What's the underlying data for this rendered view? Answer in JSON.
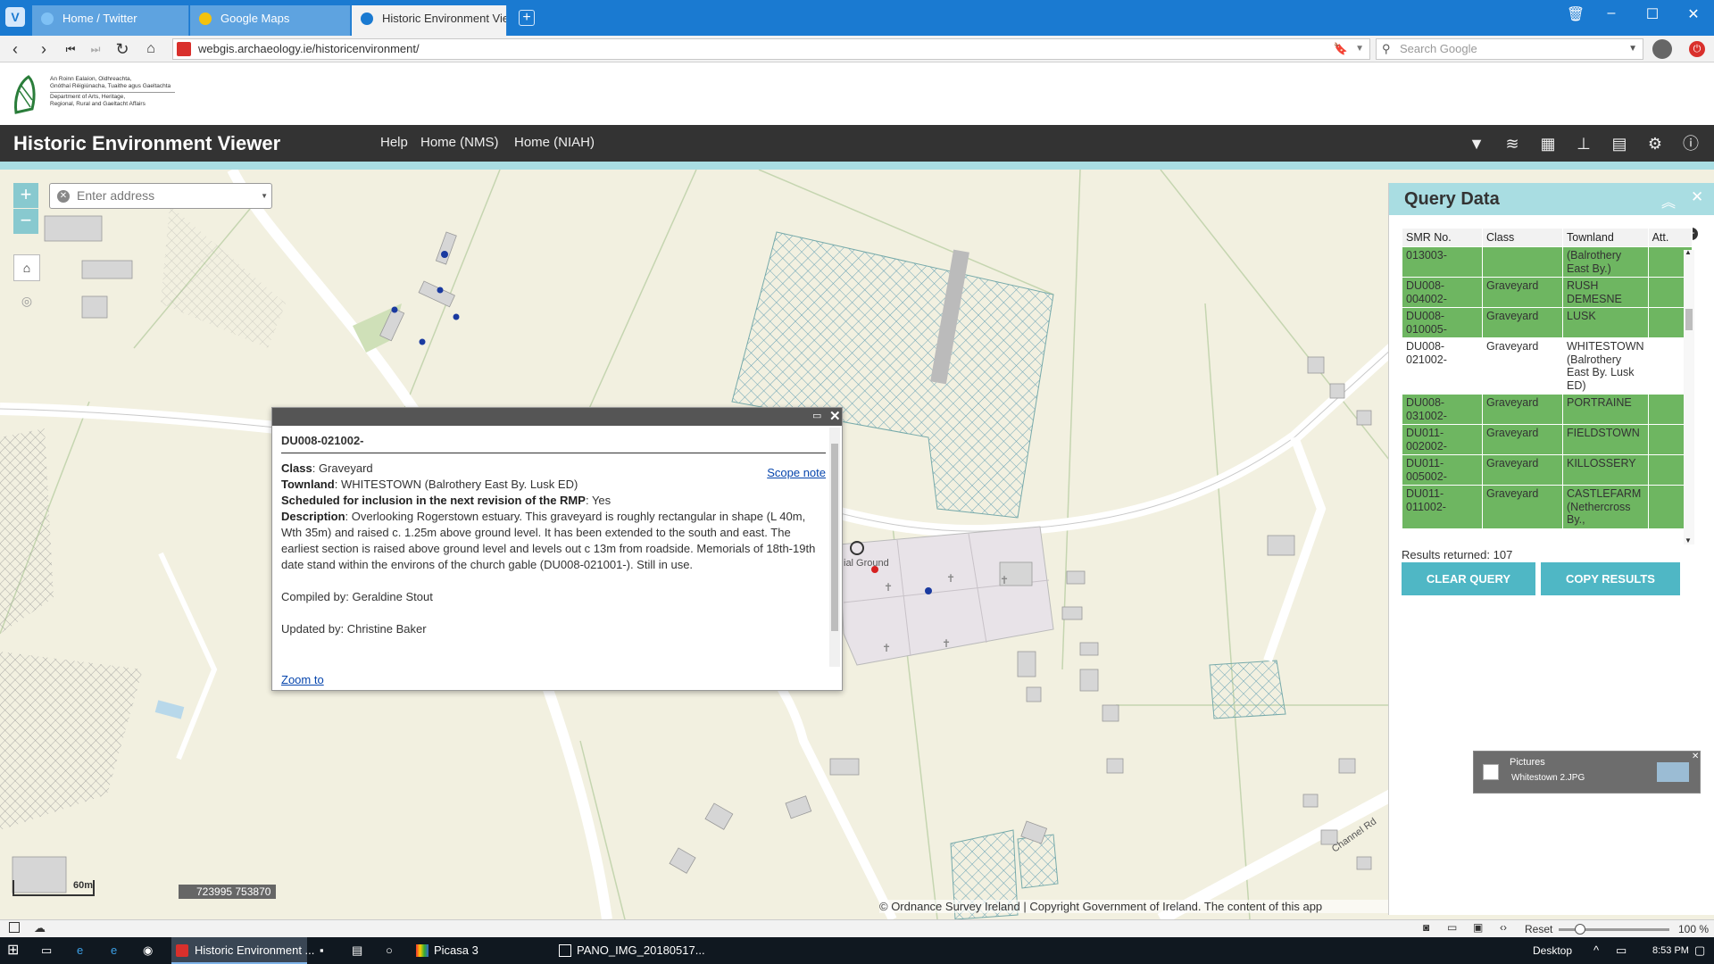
{
  "browser": {
    "tabs": [
      {
        "label": "Home / Twitter"
      },
      {
        "label": "Google Maps"
      },
      {
        "label": "Historic Environment Viewer"
      }
    ],
    "url": "webgis.archaeology.ie/historicenvironment/",
    "search_placeholder": "Search Google"
  },
  "header": {
    "logo_lines": [
      "An Roinn Ealaíon, Oidhreachta,",
      "Gnóthaí Réigiúnacha, Tuaithe agus Gaeltachta",
      "Department of Arts, Heritage,",
      "Regional, Rural and Gaeltacht Affairs"
    ],
    "app_title": "Historic Environment Viewer",
    "nav": [
      "Help",
      "Home (NMS)",
      "Home (NIAH)"
    ]
  },
  "map": {
    "address_placeholder": "Enter address",
    "scale_label": "60m",
    "coords": "723995 753870",
    "attribution": "© Ordnance Survey Ireland | Copyright Government of Ireland. The content of this app",
    "label_burial": "ial Ground",
    "label_road": "Channel Rd"
  },
  "popup": {
    "title": "DU008-021002-",
    "class_label": "Class",
    "class_value": "Graveyard",
    "scope_note": "Scope note",
    "townland_label": "Townland",
    "townland_value": "WHITESTOWN (Balrothery East By. Lusk ED)",
    "scheduled_label": "Scheduled for inclusion in the next revision of the RMP",
    "scheduled_value": "Yes",
    "desc_label": "Description",
    "desc_value": "Overlooking Rogerstown estuary. This graveyard is roughly rectangular in shape (L 40m, Wth 35m) and raised c. 1.25m above ground level. It has been extended to the south and east. The earliest section is raised above ground level and levels out c 13m from roadside. Memorials of 18th-19th date stand within the environs of the church gable (DU008-021001-). Still in use.",
    "compiled": "Compiled by: Geraldine Stout",
    "updated": "Updated by: Christine Baker",
    "zoom": "Zoom to"
  },
  "query": {
    "title": "Query Data",
    "columns": [
      "SMR No.",
      "Class",
      "Townland",
      "Att."
    ],
    "rows": [
      {
        "smr": "013003-",
        "cls": "",
        "town": "(Balrothery East By.)"
      },
      {
        "smr": "DU008-004002-",
        "cls": "Graveyard",
        "town": "RUSH DEMESNE"
      },
      {
        "smr": "DU008-010005-",
        "cls": "Graveyard",
        "town": "LUSK"
      },
      {
        "smr": "DU008-021002-",
        "cls": "Graveyard",
        "town": "WHITESTOWN (Balrothery East By. Lusk ED)"
      },
      {
        "smr": "DU008-031002-",
        "cls": "Graveyard",
        "town": "PORTRAINE"
      },
      {
        "smr": "DU011-002002-",
        "cls": "Graveyard",
        "town": "FIELDSTOWN"
      },
      {
        "smr": "DU011-005002-",
        "cls": "Graveyard",
        "town": "KILLOSSERY"
      },
      {
        "smr": "DU011-011002-",
        "cls": "Graveyard",
        "town": "CASTLEFARM (Nethercross By.,"
      }
    ],
    "results": "Results returned: 107",
    "clear": "CLEAR QUERY",
    "copy": "COPY RESULTS"
  },
  "pictures": {
    "title": "Pictures",
    "file": "Whitestown 2.JPG"
  },
  "statusbar": {
    "reset": "Reset",
    "zoom": "100 %"
  },
  "taskbar": {
    "items": [
      "Historic Environment ...",
      "Picasa 3",
      "PANO_IMG_20180517..."
    ],
    "desktop": "Desktop",
    "time": "8:53 PM"
  }
}
